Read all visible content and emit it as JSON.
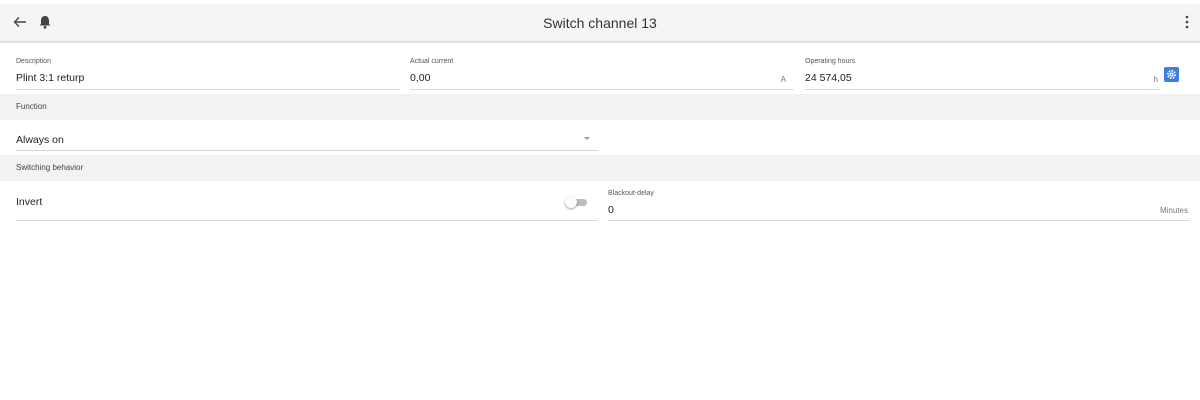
{
  "header": {
    "title": "Switch channel 13",
    "back_icon": "arrow-left-icon",
    "bell_icon": "bell-icon",
    "menu_icon": "more-vert-icon"
  },
  "fields": {
    "description": {
      "label": "Description",
      "value": "Plint 3:1 returp"
    },
    "actual_current": {
      "label": "Actual current",
      "value": "0,00",
      "unit": "A"
    },
    "operating_hours": {
      "label": "Operating hours",
      "value": "24 574,05",
      "unit": "h",
      "action_icon": "gear-icon"
    }
  },
  "sections": {
    "function": "Function",
    "switching_behavior": "Switching behavior"
  },
  "function_select": {
    "value": "Always on"
  },
  "invert": {
    "label": "Invert",
    "checked": false
  },
  "blackout_delay": {
    "label": "Blackout-delay",
    "value": "0",
    "unit": "Minutes"
  },
  "colors": {
    "accent": "#3f7fe0",
    "header_bg": "#f5f5f5",
    "section_bg": "#f2f2f2"
  }
}
